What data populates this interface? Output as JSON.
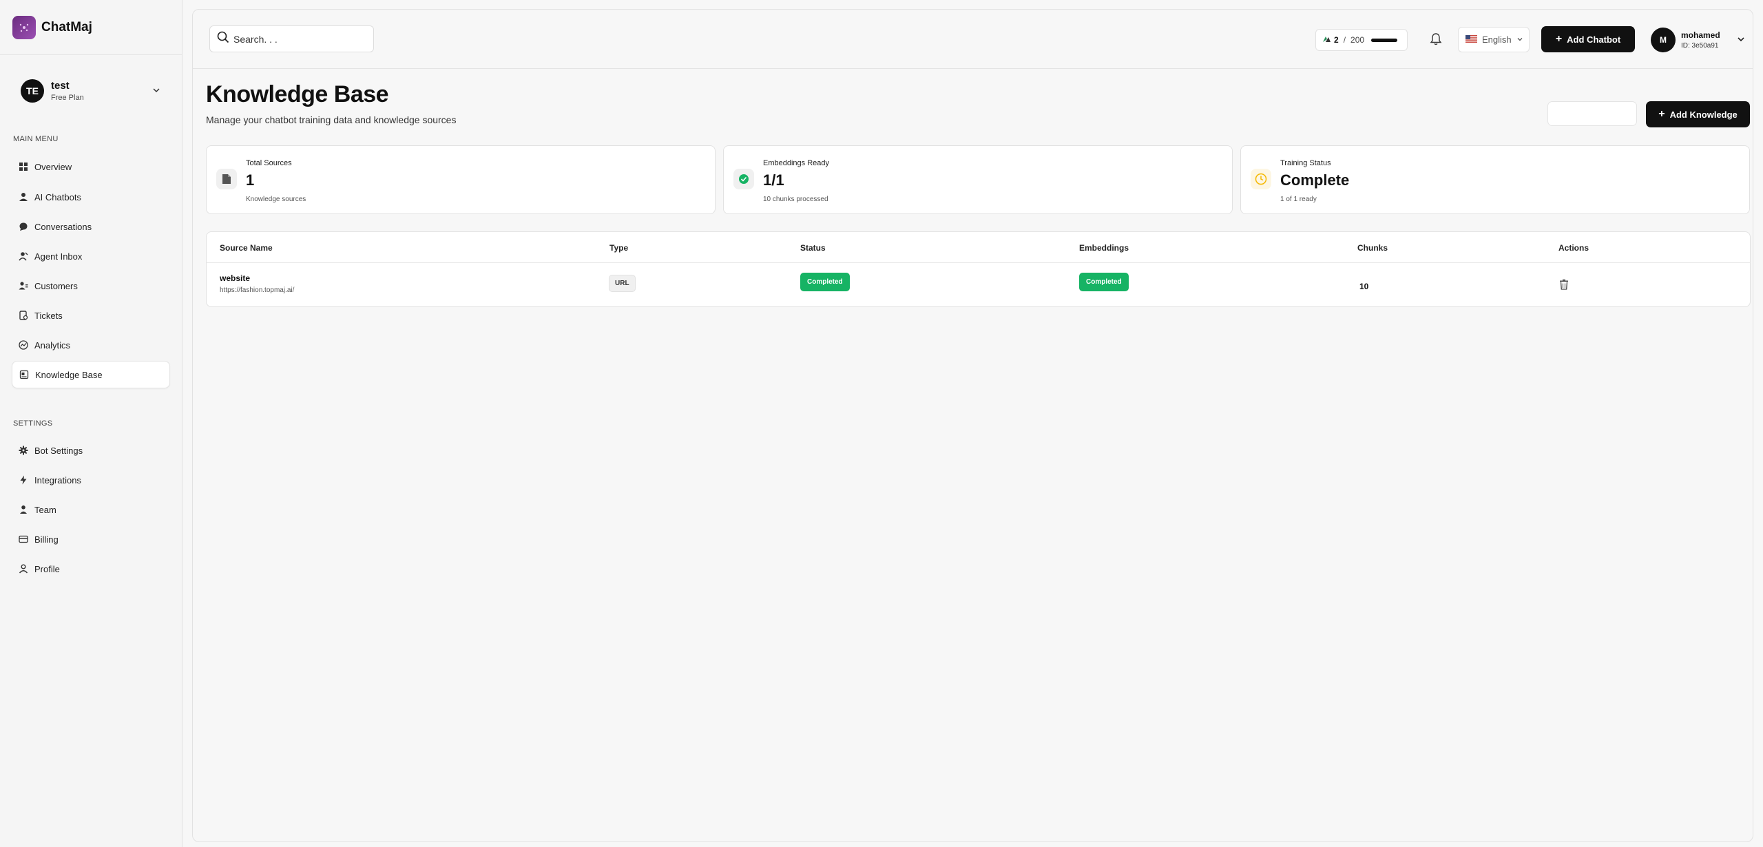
{
  "brand": {
    "name": "ChatMaj",
    "logo_icon": "chatmaj-logo"
  },
  "workspace": {
    "initials": "TE",
    "name": "test",
    "plan": "Free Plan"
  },
  "sidebar": {
    "main_menu_label": "MAIN MENU",
    "main_items": [
      {
        "label": "Overview",
        "icon": "grid-icon"
      },
      {
        "label": "AI Chatbots",
        "icon": "user-icon"
      },
      {
        "label": "Conversations",
        "icon": "chat-bubble-icon"
      },
      {
        "label": "Agent Inbox",
        "icon": "agent-icon"
      },
      {
        "label": "Customers",
        "icon": "users-icon"
      },
      {
        "label": "Tickets",
        "icon": "ticket-icon"
      },
      {
        "label": "Analytics",
        "icon": "analytics-icon"
      },
      {
        "label": "Knowledge Base",
        "icon": "book-icon",
        "active": true
      }
    ],
    "settings_label": "SETTINGS",
    "settings_items": [
      {
        "label": "Bot Settings",
        "icon": "gear-icon"
      },
      {
        "label": "Integrations",
        "icon": "bolt-icon"
      },
      {
        "label": "Team",
        "icon": "team-icon"
      },
      {
        "label": "Billing",
        "icon": "card-icon"
      },
      {
        "label": "Profile",
        "icon": "profile-icon"
      }
    ]
  },
  "header": {
    "search_placeholder": "Search. . .",
    "credits": {
      "used": "2",
      "separator": "/",
      "total": "200",
      "usage_fraction": 0.99
    },
    "language": "English",
    "add_chatbot_label": "Add Chatbot",
    "user": {
      "initial": "M",
      "name": "mohamed",
      "id": "ID: 3e50a91"
    }
  },
  "page": {
    "title": "Knowledge Base",
    "subtitle": "Manage your chatbot training data and knowledge sources",
    "add_knowledge_label": "Add Knowledge"
  },
  "stats": [
    {
      "label": "Total Sources",
      "value": "1",
      "foot": "Knowledge sources",
      "icon": "document-icon"
    },
    {
      "label": "Embeddings Ready",
      "value": "1/1",
      "foot": "10 chunks processed",
      "icon": "check-circle-icon"
    },
    {
      "label": "Training Status",
      "value": "Complete",
      "foot": "1 of 1 ready",
      "icon": "clock-icon"
    }
  ],
  "table": {
    "columns": [
      "Source Name",
      "Type",
      "Status",
      "Embeddings",
      "Chunks",
      "Actions"
    ],
    "rows": [
      {
        "name": "website",
        "url": "https://fashion.topmaj.ai/",
        "type": "URL",
        "status": "Completed",
        "embeddings": "Completed",
        "chunks": "10"
      }
    ]
  },
  "colors": {
    "accent_dark": "#111111",
    "success": "#16b364",
    "brand_purple": "#7b3592",
    "clock": "#f5b800"
  }
}
